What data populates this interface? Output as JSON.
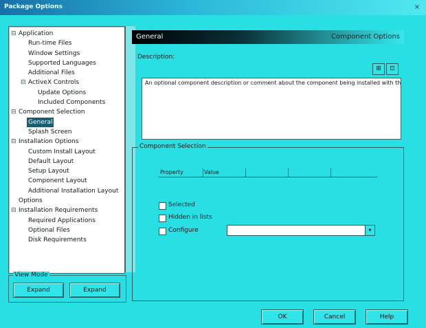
{
  "window": {
    "title": "Package Options",
    "close_glyph": "×"
  },
  "tree": [
    {
      "label": "Application",
      "level": 0,
      "exp": "⊟"
    },
    {
      "label": "Run-time Files",
      "level": 1
    },
    {
      "label": "Window Settings",
      "level": 1
    },
    {
      "label": "Supported Languages",
      "level": 1
    },
    {
      "label": "Additional Files",
      "level": 1
    },
    {
      "label": "ActiveX Controls",
      "level": 1,
      "exp": "⊟"
    },
    {
      "label": "Update Options",
      "level": 2
    },
    {
      "label": "Included Components",
      "level": 2
    },
    {
      "label": "Component Selection",
      "level": 0,
      "exp": "⊟"
    },
    {
      "label": "General",
      "level": 1,
      "selected": true
    },
    {
      "label": "Splash Screen",
      "level": 1
    },
    {
      "label": "Installation Options",
      "level": 0,
      "exp": "⊟"
    },
    {
      "label": "Custom Install Layout",
      "level": 1
    },
    {
      "label": "Default Layout",
      "level": 1
    },
    {
      "label": "Setup Layout",
      "level": 1
    },
    {
      "label": "Component Layout",
      "level": 1
    },
    {
      "label": "Additional Installation Layout",
      "level": 1
    },
    {
      "label": "Options",
      "level": 0
    },
    {
      "label": "Installation Requirements",
      "level": 0,
      "exp": "⊟"
    },
    {
      "label": "Required Applications",
      "level": 1
    },
    {
      "label": "Optional Files",
      "level": 1
    },
    {
      "label": "Disk Requirements",
      "level": 1
    }
  ],
  "left_group": {
    "label": "View Mode",
    "buttons": [
      "Expand",
      "Expand"
    ]
  },
  "right": {
    "header_left": "General",
    "header_right": "Component Options",
    "desc_label": "Description:",
    "desc_text": "An optional component description or comment about the component being installed with the package.",
    "icon_buttons": [
      "⊞",
      "⊡"
    ],
    "group_label": "Component Selection",
    "columns": [
      "Property",
      "Value",
      "",
      ""
    ],
    "checkboxes": [
      "Selected",
      "Hidden in lists",
      "Configure"
    ]
  },
  "footer": {
    "buttons": [
      "OK",
      "Cancel",
      "Help"
    ]
  }
}
